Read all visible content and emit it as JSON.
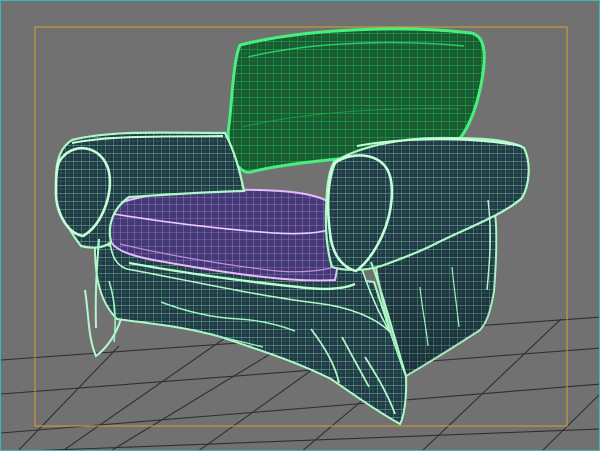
{
  "viewport": {
    "background_color": "#717171",
    "border_color": "#3bb7b8",
    "safe_frame_color": "#d6a22a",
    "grid_color": "#303030"
  },
  "model": {
    "name": "armchair",
    "display_mode": "wireframe",
    "colors": {
      "body_fill": "#203645",
      "body_wire": "#8ff2bb",
      "body_edge": "#aef8c8",
      "back_fill": "#1b5632",
      "back_wire": "#1ee25b",
      "back_edge": "#47f07e",
      "seat_fill": "#433a75",
      "seat_wire": "#d39ff1",
      "seat_edge": "#e9b9ff"
    }
  }
}
